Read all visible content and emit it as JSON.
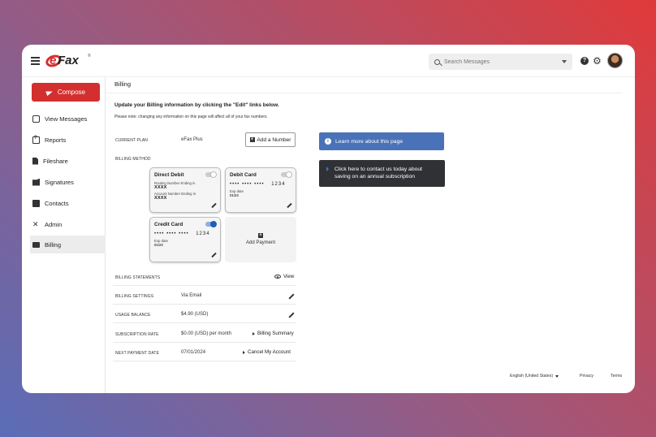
{
  "app": {
    "logo_text_e": "e",
    "logo_text_fax": "Fax",
    "logo_reg": "®"
  },
  "header": {
    "search_placeholder": "Search Messages",
    "help_glyph": "?",
    "settings_glyph": "⚙"
  },
  "sidebar": {
    "compose_label": "Compose",
    "items": [
      {
        "label": "View Messages",
        "icon": "inbox-icon"
      },
      {
        "label": "Reports",
        "icon": "reports-icon"
      },
      {
        "label": "Fileshare",
        "icon": "file-icon"
      },
      {
        "label": "Signatures",
        "icon": "signature-icon"
      },
      {
        "label": "Contacts",
        "icon": "contacts-icon"
      },
      {
        "label": "Admin",
        "icon": "admin-tools-icon"
      },
      {
        "label": "Billing",
        "icon": "billing-card-icon",
        "active": true
      }
    ]
  },
  "main": {
    "page_title": "Billing",
    "heading": "Update your Billing information by clicking the \"Edit\" links below.",
    "note": "Please note: changing any information on this page will affect all of your fax numbers.",
    "current_plan": {
      "label": "CURRENT PLAN",
      "value": "eFax Plus",
      "button": "Add a Number"
    },
    "billing_method": {
      "label": "BILLING METHOD",
      "direct_debit": {
        "title": "Direct Debit",
        "routing_label": "Routing Number Ending in",
        "routing_value": "XXXX",
        "account_label": "Account Number Ending in",
        "account_value": "XXXX",
        "enabled": false
      },
      "debit_card": {
        "title": "Debit Card",
        "masked": "•••• •••• ••••",
        "last4": "1234",
        "exp_label": "Exp date",
        "exp_value": "01/23",
        "enabled": false
      },
      "credit_card": {
        "title": "Credit Card",
        "masked": "•••• •••• ••••",
        "last4": "1234",
        "exp_label": "Exp date",
        "exp_value": "01/23",
        "enabled": true
      },
      "add_payment": "Add Payment"
    },
    "billing_statements": {
      "label": "BILLING STATEMENTS",
      "action": "View"
    },
    "billing_settings": {
      "label": "BILLING SETTINGS",
      "value": "Via Email"
    },
    "usage_balance": {
      "label": "USAGE BALANCE",
      "value": "$4.90 (USD)"
    },
    "subscription_rate": {
      "label": "SUBSCRIPTION RATE",
      "value": "$0.00 (USD) per month",
      "action": "Billing Summary"
    },
    "next_payment": {
      "label": "NEXT PAYMENT DATE",
      "value": "07/01/2024",
      "action": "Cancel My Account"
    }
  },
  "side_panel": {
    "learn_more": "Learn more about this page",
    "contact_line1": "Click here to contact us today about",
    "contact_line2": "saving on an annual subscription"
  },
  "footer": {
    "language": "English (United States)",
    "privacy": "Privacy",
    "terms": "Terms"
  },
  "colors": {
    "brand_red": "#d32f2f",
    "accent_blue": "#4a72b8",
    "dark_box": "#2f3135"
  }
}
